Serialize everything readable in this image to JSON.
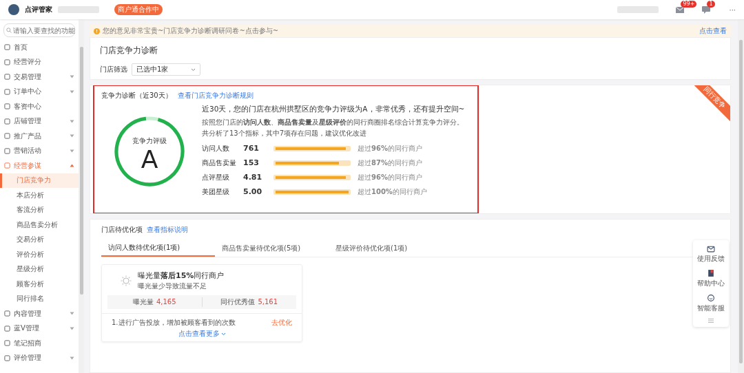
{
  "header": {
    "app_name": "点评管家",
    "status_badge": "商户通合作中",
    "mail_badge": "99+",
    "chat_badge": "1",
    "more": "···"
  },
  "sidebar": {
    "search": {
      "placeholder": "请输入要查找的功能"
    },
    "items": [
      {
        "label": "首页",
        "selected": false
      },
      {
        "label": "经营评分",
        "selected": false
      },
      {
        "label": "交易管理",
        "expanded": false,
        "selected": false
      },
      {
        "label": "订单中心",
        "expanded": false,
        "selected": false
      },
      {
        "label": "客资中心",
        "selected": false
      },
      {
        "label": "店铺管理",
        "expanded": false,
        "selected": false
      },
      {
        "label": "推广产品",
        "expanded": false,
        "selected": false
      },
      {
        "label": "营销活动",
        "expanded": false,
        "selected": false
      },
      {
        "label": "经营参谋",
        "expanded": true,
        "selected": true,
        "children": [
          {
            "label": "门店竞争力",
            "selected": true
          },
          {
            "label": "本店分析",
            "selected": false
          },
          {
            "label": "客流分析",
            "selected": false
          },
          {
            "label": "商品售卖分析",
            "selected": false
          },
          {
            "label": "交易分析",
            "selected": false
          },
          {
            "label": "评价分析",
            "selected": false
          },
          {
            "label": "星级分析",
            "selected": false
          },
          {
            "label": "顾客分析",
            "selected": false
          },
          {
            "label": "同行排名",
            "selected": false
          }
        ]
      },
      {
        "label": "内容管理",
        "expanded": false,
        "selected": false
      },
      {
        "label": "蓝V管理",
        "expanded": false,
        "selected": false
      },
      {
        "label": "笔记招商",
        "selected": false
      },
      {
        "label": "评价管理",
        "expanded": false,
        "selected": false
      }
    ]
  },
  "notice": {
    "text": "您的意见非常宝贵~门店竞争力诊断调研问卷~点击参与~",
    "link": "点击查看"
  },
  "page": {
    "title": "门店竞争力诊断",
    "filter_label": "门店筛选",
    "filter_value": "已选中1家"
  },
  "diagnosis": {
    "title": "竞争力诊断（近30天）",
    "rule_link": "查看门店竞争力诊断规则",
    "ribbon": "同行竞争",
    "rating_label": "竞争力评级",
    "rating": "A",
    "summary": "近30天，您的门店在杭州拱墅区的竞争力评级为A，非常优秀，还有提升空间~",
    "explain": "按照您门店的**访问人数**、**商品售卖量**及**星级评价**的同行商圈排名综合计算竞争力评分。",
    "analysis": "共分析了13个指标，其中7项存在问题，建议优化改进",
    "metrics": [
      {
        "name": "访问人数",
        "value": "761",
        "level": 0.96,
        "note": "超过**96%**的同行商户"
      },
      {
        "name": "商品售卖量",
        "value": "153",
        "level": 0.87,
        "note": "超过**87%**的同行商户"
      },
      {
        "name": "点评星级",
        "value": "4.81",
        "level": 0.96,
        "note": "超过**96%**的同行商户"
      },
      {
        "name": "美团星级",
        "value": "5.00",
        "level": 1.0,
        "note": "超过**100%**的同行商户"
      }
    ]
  },
  "optimize": {
    "title": "门店待优化项",
    "link": "查看指标说明",
    "tabs": [
      {
        "label": "访问人数待优化项(1项)",
        "selected": true
      },
      {
        "label": "商品售卖量待优化项(5项)",
        "selected": false
      },
      {
        "label": "星级评价待优化项(1项)",
        "selected": false
      }
    ],
    "card": {
      "headline": "曝光量**落后15%**同行商户",
      "sub": "曝光量少导致流量不足",
      "stats": [
        {
          "label": "曝光量",
          "value": "4,165"
        },
        {
          "label": "同行优秀值",
          "value": "5,161"
        }
      ],
      "tip": "1.进行广告投放，增加被顾客看到的次数",
      "action": "去优化",
      "more": "点击查看更多"
    }
  },
  "float_panel": [
    {
      "kind": "feedback",
      "label": "使用反馈"
    },
    {
      "kind": "help",
      "label": "帮助中心"
    },
    {
      "kind": "service",
      "label": "智能客服"
    }
  ]
}
